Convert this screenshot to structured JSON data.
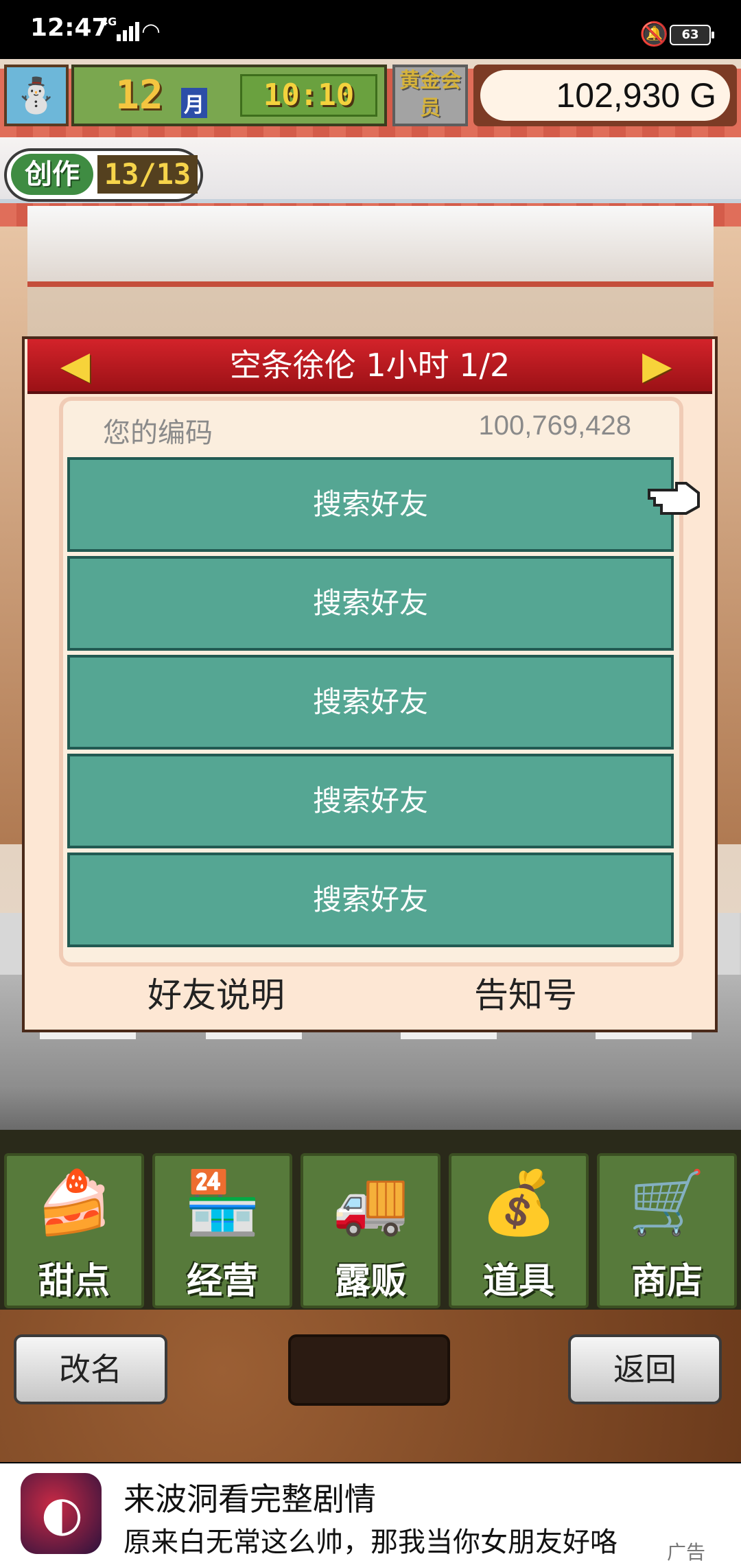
{
  "status_bar": {
    "time": "12:47",
    "network": "4G",
    "battery": "63"
  },
  "hud": {
    "month_number": "12",
    "month_label": "月",
    "clock": "10:10",
    "member_badge": "黄金会员",
    "money": "102,930 G",
    "create_label": "创作",
    "create_count": "13/13"
  },
  "dialog": {
    "title": "空条徐伦  1小时 1/2",
    "code_label": "您的编码",
    "code_value": "100,769,428",
    "friend_slots": [
      "搜索好友",
      "搜索好友",
      "搜索好友",
      "搜索好友",
      "搜索好友"
    ],
    "help_button": "好友说明",
    "notify_button": "告知号"
  },
  "menu": {
    "items": [
      {
        "label": "甜点",
        "icon": "cake-icon"
      },
      {
        "label": "经营",
        "icon": "shop-building-icon"
      },
      {
        "label": "露贩",
        "icon": "food-truck-icon"
      },
      {
        "label": "道具",
        "icon": "item-bag-icon"
      },
      {
        "label": "商店",
        "icon": "shopping-cart-icon"
      }
    ]
  },
  "actions": {
    "rename": "改名",
    "back": "返回"
  },
  "ad": {
    "title": "来波洞看完整剧情",
    "subtitle": "原来白无常这么帅，那我当你女朋友好咯",
    "tag": "广告"
  }
}
